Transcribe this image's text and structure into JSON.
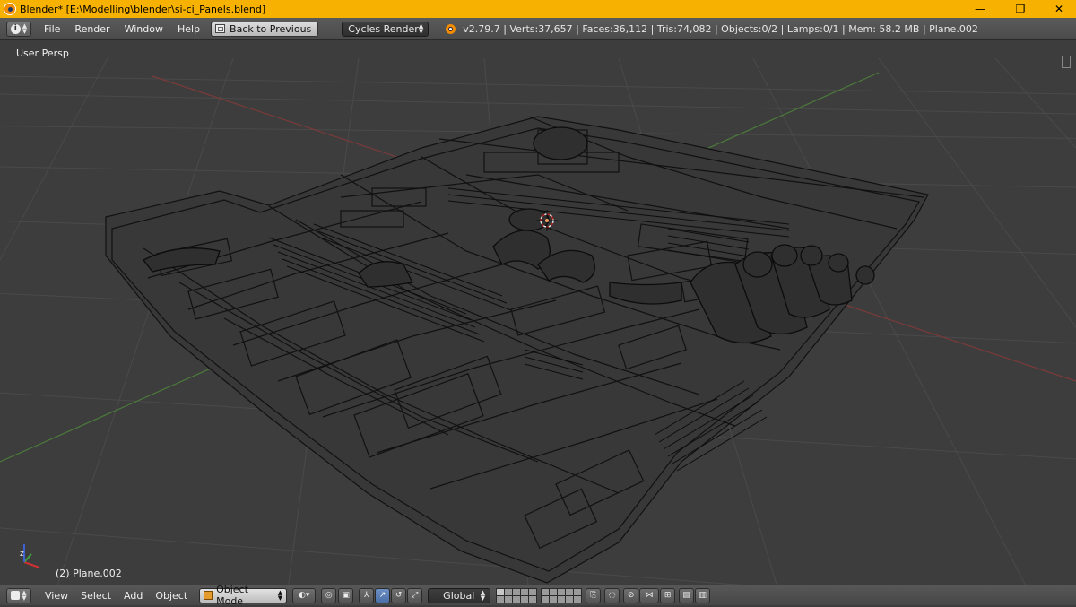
{
  "window": {
    "title": "Blender* [E:\\Modelling\\blender\\si-ci_Panels.blend]",
    "controls": {
      "minimize": "—",
      "maximize": "❐",
      "close": "✕"
    }
  },
  "info_header": {
    "menus": [
      "File",
      "Render",
      "Window",
      "Help"
    ],
    "back_button": "Back to Previous",
    "render_engine": "Cycles Render",
    "stats": "v2.79.7 | Verts:37,657 | Faces:36,112 | Tris:74,082 | Objects:0/2 | Lamps:0/1 | Mem: 58.2 MB | Plane.002"
  },
  "viewport": {
    "view_label": "User Persp",
    "object_label": "(2) Plane.002",
    "colors": {
      "background": "#3d3d3d",
      "grid": "#4a4a4a",
      "x_axis": "#7a3a3a",
      "y_axis": "#4b7a3a",
      "wire": "#111111"
    }
  },
  "view3d_header": {
    "menus": [
      "View",
      "Select",
      "Add",
      "Object"
    ],
    "mode": "Object Mode",
    "orientation": "Global"
  },
  "icons": [
    "info-icon",
    "blender-logo-icon",
    "cube-icon",
    "viewport-shading-icon",
    "pivot-icon",
    "manipulator-icon",
    "snap-icon",
    "render-icon",
    "axis-gizmo-icon"
  ]
}
